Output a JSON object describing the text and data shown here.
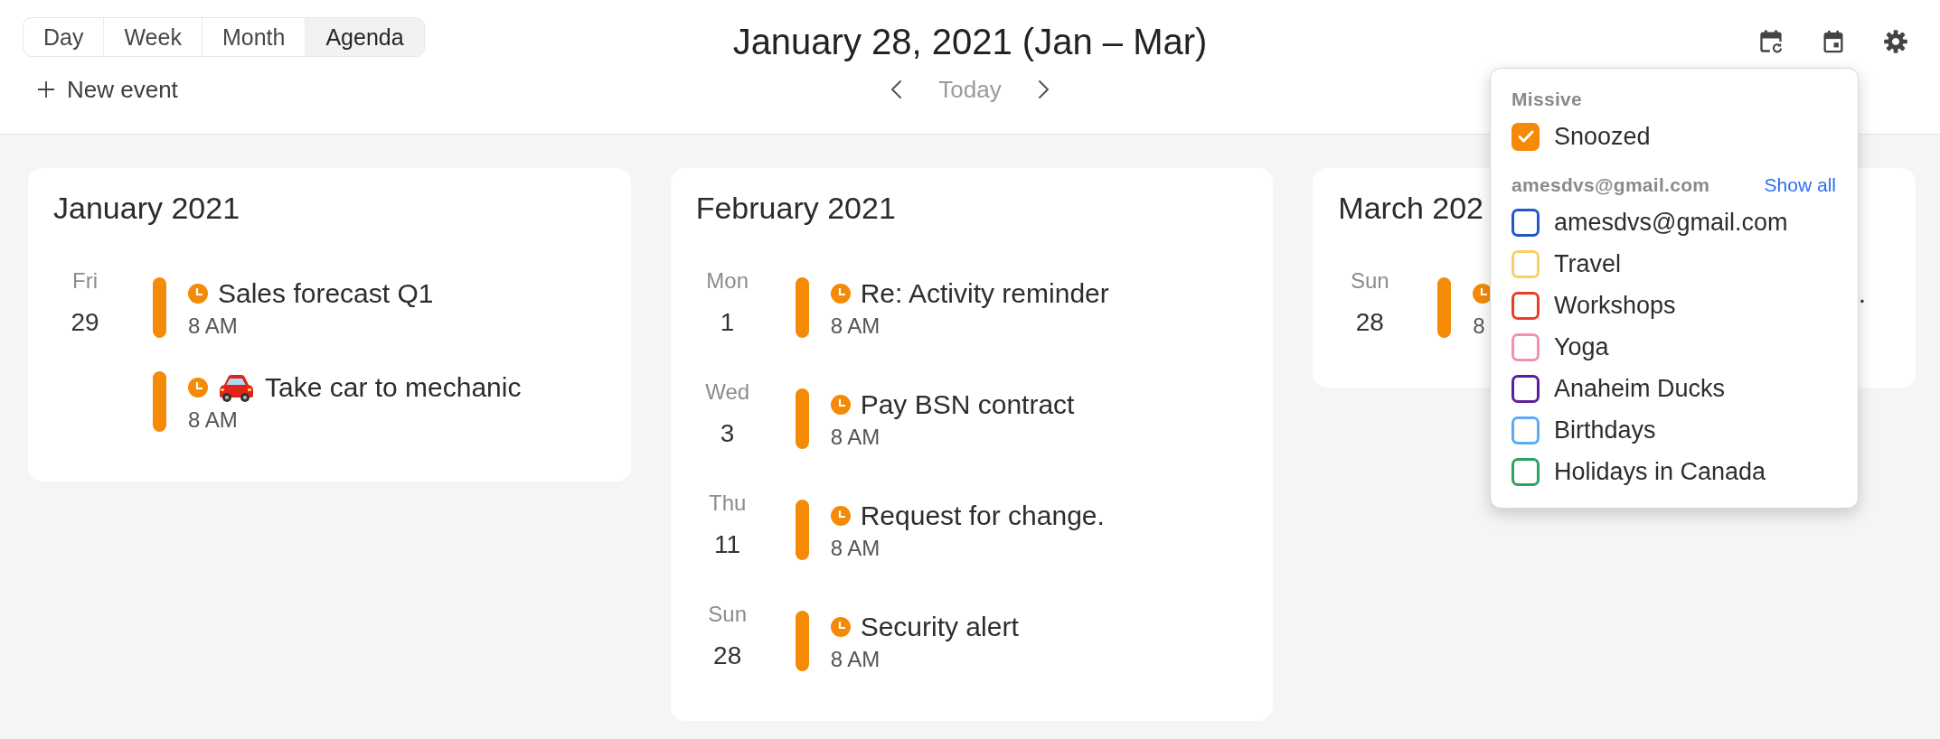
{
  "view_tabs": [
    {
      "label": "Day",
      "selected": false
    },
    {
      "label": "Week",
      "selected": false
    },
    {
      "label": "Month",
      "selected": false
    },
    {
      "label": "Agenda",
      "selected": true
    }
  ],
  "new_event": {
    "label": "New event"
  },
  "header": {
    "title": "January 28, 2021 (Jan – Mar)",
    "today": "Today"
  },
  "months": [
    {
      "title": "January 2021",
      "days": [
        {
          "weekday": "Fri",
          "date": "29",
          "events": [
            {
              "title": "Sales forecast Q1",
              "time": "8 AM",
              "has_icon": false
            },
            {
              "title": "Take car to mechanic",
              "time": "8 AM",
              "has_icon": true
            }
          ]
        }
      ]
    },
    {
      "title": "February 2021",
      "days": [
        {
          "weekday": "Mon",
          "date": "1",
          "events": [
            {
              "title": "Re: Activity reminder",
              "time": "8 AM",
              "has_icon": false
            }
          ]
        },
        {
          "weekday": "Wed",
          "date": "3",
          "events": [
            {
              "title": "Pay BSN contract",
              "time": "8 AM",
              "has_icon": false
            }
          ]
        },
        {
          "weekday": "Thu",
          "date": "11",
          "events": [
            {
              "title": "Request for change.",
              "time": "8 AM",
              "has_icon": false
            }
          ]
        },
        {
          "weekday": "Sun",
          "date": "28",
          "events": [
            {
              "title": "Security alert",
              "time": "8 AM",
              "has_icon": false
            }
          ]
        }
      ]
    },
    {
      "title": "March 202",
      "days": [
        {
          "weekday": "Sun",
          "date": "28",
          "events": [
            {
              "title_tail": ".",
              "time": "8",
              "has_icon": false
            }
          ]
        }
      ]
    }
  ],
  "calendar_menu": {
    "sections": [
      {
        "heading": "Missive",
        "items": [
          {
            "label": "Snoozed",
            "checked": true,
            "color": "#f58a07"
          }
        ]
      },
      {
        "heading": "amesdvs@gmail.com",
        "action": "Show all",
        "items": [
          {
            "label": "amesdvs@gmail.com",
            "checked": false,
            "color": "#1f56d1"
          },
          {
            "label": "Travel",
            "checked": false,
            "color": "#f9cf68"
          },
          {
            "label": "Workshops",
            "checked": false,
            "color": "#f03a23"
          },
          {
            "label": "Yoga",
            "checked": false,
            "color": "#f48fb1"
          },
          {
            "label": "Anaheim Ducks",
            "checked": false,
            "color": "#5b1f98"
          },
          {
            "label": "Birthdays",
            "checked": false,
            "color": "#5aabf6"
          },
          {
            "label": "Holidays in Canada",
            "checked": false,
            "color": "#2aa35e"
          }
        ]
      }
    ]
  }
}
